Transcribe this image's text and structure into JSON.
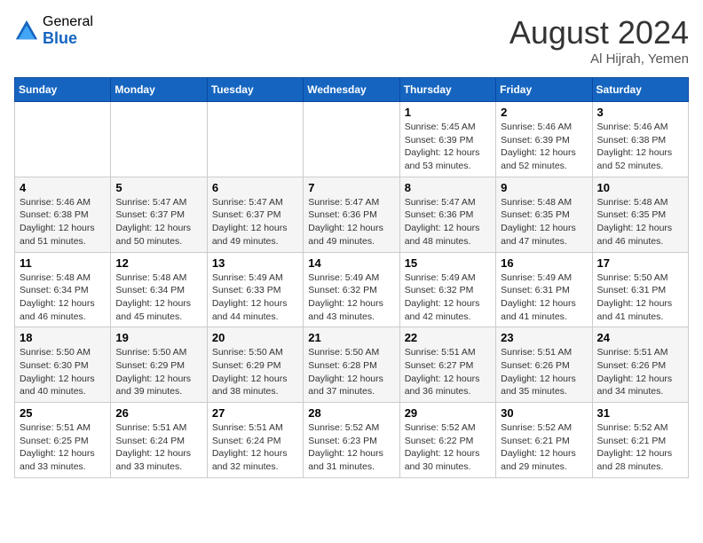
{
  "header": {
    "logo_general": "General",
    "logo_blue": "Blue",
    "month_title": "August 2024",
    "location": "Al Hijrah, Yemen"
  },
  "weekdays": [
    "Sunday",
    "Monday",
    "Tuesday",
    "Wednesday",
    "Thursday",
    "Friday",
    "Saturday"
  ],
  "weeks": [
    [
      {
        "day": "",
        "info": ""
      },
      {
        "day": "",
        "info": ""
      },
      {
        "day": "",
        "info": ""
      },
      {
        "day": "",
        "info": ""
      },
      {
        "day": "1",
        "info": "Sunrise: 5:45 AM\nSunset: 6:39 PM\nDaylight: 12 hours\nand 53 minutes."
      },
      {
        "day": "2",
        "info": "Sunrise: 5:46 AM\nSunset: 6:39 PM\nDaylight: 12 hours\nand 52 minutes."
      },
      {
        "day": "3",
        "info": "Sunrise: 5:46 AM\nSunset: 6:38 PM\nDaylight: 12 hours\nand 52 minutes."
      }
    ],
    [
      {
        "day": "4",
        "info": "Sunrise: 5:46 AM\nSunset: 6:38 PM\nDaylight: 12 hours\nand 51 minutes."
      },
      {
        "day": "5",
        "info": "Sunrise: 5:47 AM\nSunset: 6:37 PM\nDaylight: 12 hours\nand 50 minutes."
      },
      {
        "day": "6",
        "info": "Sunrise: 5:47 AM\nSunset: 6:37 PM\nDaylight: 12 hours\nand 49 minutes."
      },
      {
        "day": "7",
        "info": "Sunrise: 5:47 AM\nSunset: 6:36 PM\nDaylight: 12 hours\nand 49 minutes."
      },
      {
        "day": "8",
        "info": "Sunrise: 5:47 AM\nSunset: 6:36 PM\nDaylight: 12 hours\nand 48 minutes."
      },
      {
        "day": "9",
        "info": "Sunrise: 5:48 AM\nSunset: 6:35 PM\nDaylight: 12 hours\nand 47 minutes."
      },
      {
        "day": "10",
        "info": "Sunrise: 5:48 AM\nSunset: 6:35 PM\nDaylight: 12 hours\nand 46 minutes."
      }
    ],
    [
      {
        "day": "11",
        "info": "Sunrise: 5:48 AM\nSunset: 6:34 PM\nDaylight: 12 hours\nand 46 minutes."
      },
      {
        "day": "12",
        "info": "Sunrise: 5:48 AM\nSunset: 6:34 PM\nDaylight: 12 hours\nand 45 minutes."
      },
      {
        "day": "13",
        "info": "Sunrise: 5:49 AM\nSunset: 6:33 PM\nDaylight: 12 hours\nand 44 minutes."
      },
      {
        "day": "14",
        "info": "Sunrise: 5:49 AM\nSunset: 6:32 PM\nDaylight: 12 hours\nand 43 minutes."
      },
      {
        "day": "15",
        "info": "Sunrise: 5:49 AM\nSunset: 6:32 PM\nDaylight: 12 hours\nand 42 minutes."
      },
      {
        "day": "16",
        "info": "Sunrise: 5:49 AM\nSunset: 6:31 PM\nDaylight: 12 hours\nand 41 minutes."
      },
      {
        "day": "17",
        "info": "Sunrise: 5:50 AM\nSunset: 6:31 PM\nDaylight: 12 hours\nand 41 minutes."
      }
    ],
    [
      {
        "day": "18",
        "info": "Sunrise: 5:50 AM\nSunset: 6:30 PM\nDaylight: 12 hours\nand 40 minutes."
      },
      {
        "day": "19",
        "info": "Sunrise: 5:50 AM\nSunset: 6:29 PM\nDaylight: 12 hours\nand 39 minutes."
      },
      {
        "day": "20",
        "info": "Sunrise: 5:50 AM\nSunset: 6:29 PM\nDaylight: 12 hours\nand 38 minutes."
      },
      {
        "day": "21",
        "info": "Sunrise: 5:50 AM\nSunset: 6:28 PM\nDaylight: 12 hours\nand 37 minutes."
      },
      {
        "day": "22",
        "info": "Sunrise: 5:51 AM\nSunset: 6:27 PM\nDaylight: 12 hours\nand 36 minutes."
      },
      {
        "day": "23",
        "info": "Sunrise: 5:51 AM\nSunset: 6:26 PM\nDaylight: 12 hours\nand 35 minutes."
      },
      {
        "day": "24",
        "info": "Sunrise: 5:51 AM\nSunset: 6:26 PM\nDaylight: 12 hours\nand 34 minutes."
      }
    ],
    [
      {
        "day": "25",
        "info": "Sunrise: 5:51 AM\nSunset: 6:25 PM\nDaylight: 12 hours\nand 33 minutes."
      },
      {
        "day": "26",
        "info": "Sunrise: 5:51 AM\nSunset: 6:24 PM\nDaylight: 12 hours\nand 33 minutes."
      },
      {
        "day": "27",
        "info": "Sunrise: 5:51 AM\nSunset: 6:24 PM\nDaylight: 12 hours\nand 32 minutes."
      },
      {
        "day": "28",
        "info": "Sunrise: 5:52 AM\nSunset: 6:23 PM\nDaylight: 12 hours\nand 31 minutes."
      },
      {
        "day": "29",
        "info": "Sunrise: 5:52 AM\nSunset: 6:22 PM\nDaylight: 12 hours\nand 30 minutes."
      },
      {
        "day": "30",
        "info": "Sunrise: 5:52 AM\nSunset: 6:21 PM\nDaylight: 12 hours\nand 29 minutes."
      },
      {
        "day": "31",
        "info": "Sunrise: 5:52 AM\nSunset: 6:21 PM\nDaylight: 12 hours\nand 28 minutes."
      }
    ]
  ]
}
